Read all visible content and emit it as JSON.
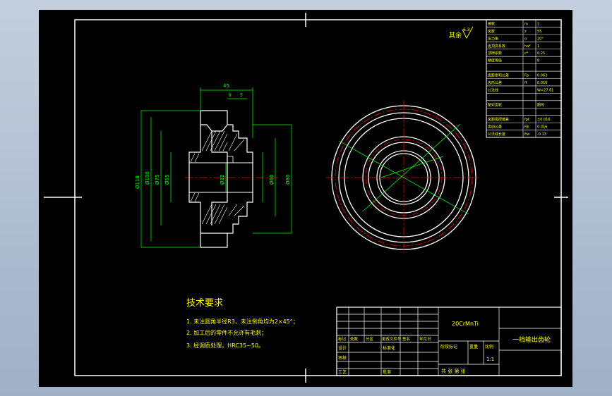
{
  "drawing": {
    "surface_finish_note": "其余",
    "surface_finish_value": "6.3",
    "dim_top_width": "45",
    "dim_hub_a": "8",
    "dim_hub_b": "5",
    "dim_left_outer": "Ø118",
    "dim_left_2": "Ø100",
    "dim_left_3": "Ø75",
    "dim_left_4": "Ø55",
    "dim_right_1": "Ø80",
    "dim_right_2": "Ø60",
    "dim_bore": "Ø32"
  },
  "param_table": {
    "rows": [
      [
        "模数",
        "m",
        "2"
      ],
      [
        "齿数",
        "z",
        "55"
      ],
      [
        "压力角",
        "α",
        "20°"
      ],
      [
        "齿顶高系数",
        "ha*",
        "1"
      ],
      [
        "顶隙系数",
        "c*",
        "0.25"
      ],
      [
        "精度等级",
        "",
        "8"
      ],
      [
        "",
        "",
        ""
      ],
      [
        "齿距累积公差",
        "Fp",
        "0.063"
      ],
      [
        "齿形公差",
        "ff",
        "0.016"
      ],
      [
        "公法线",
        "",
        "W=27.61"
      ],
      [
        "",
        "",
        ""
      ],
      [
        "配对齿轮",
        "",
        "图号"
      ],
      [
        "",
        "",
        ""
      ],
      [
        "齿距极限偏差",
        "fpt",
        "±0.016"
      ],
      [
        "齿向公差",
        "Fβ",
        "0.016"
      ],
      [
        "公法线长度",
        "Ew",
        "-0.13"
      ]
    ]
  },
  "tech_req": {
    "title": "技术要求",
    "items": [
      "1. 未注圆角半径R3，未注倒角均为2×45°；",
      "2. 加工后的零件不允许有毛刺；",
      "3. 经调质处理，HRC35~50。"
    ]
  },
  "title_block": {
    "material": "20CrMnTi",
    "part_name": "一档输出齿轮",
    "scale": "1:1",
    "label_stage": "阶段标记",
    "label_weight": "重量",
    "label_scale": "比例",
    "header_row": [
      "标记",
      "处数",
      "分区",
      "更改文件号",
      "签名",
      "年月日"
    ],
    "label_design": "设计",
    "label_std": "标准化",
    "label_check": "审核",
    "label_craft": "工艺",
    "label_approve": "批准",
    "footer_sheets": "共   张   第   张"
  },
  "colors": {
    "line": "#ffffff",
    "dimension": "#00ff00",
    "center": "#ff0000",
    "text": "#ffff00",
    "hatch": "#ff00ff"
  }
}
